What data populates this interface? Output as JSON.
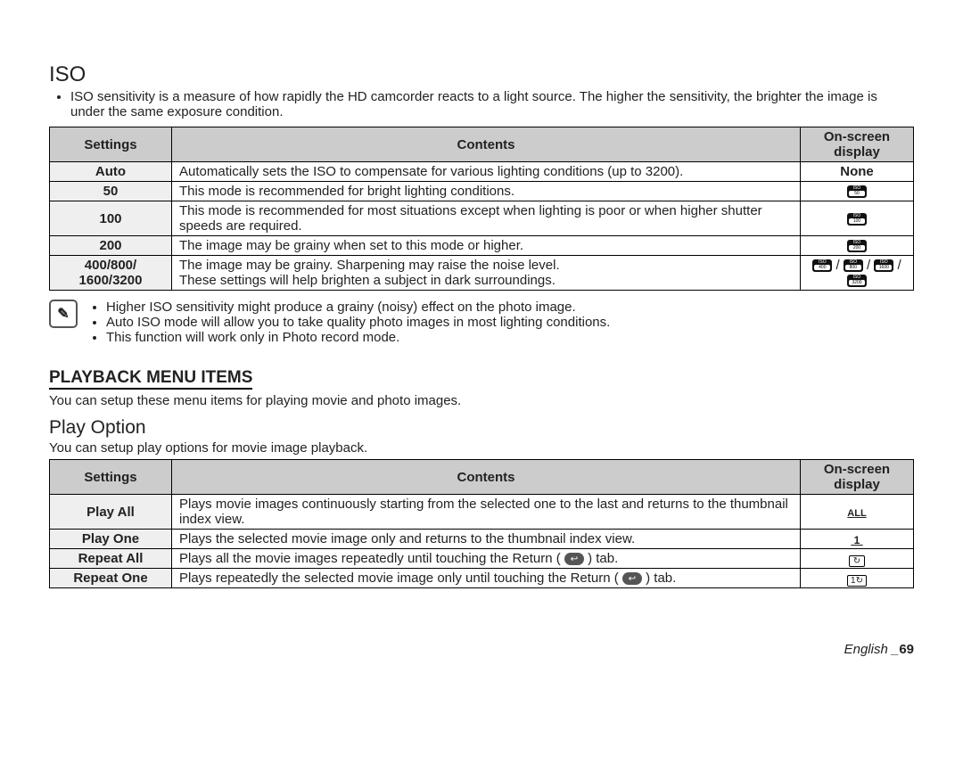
{
  "iso": {
    "title": "ISO",
    "intro": "ISO sensitivity is a measure of how rapidly the HD camcorder reacts to a light source. The higher the sensitivity, the brighter the image is under the same exposure condition.",
    "headers": {
      "settings": "Settings",
      "contents": "Contents",
      "osd": "On-screen display"
    },
    "rows": [
      {
        "setting": "Auto",
        "content": "Automatically sets the ISO to compensate for various lighting conditions (up to 3200).",
        "osd_text": "None"
      },
      {
        "setting": "50",
        "content": "This mode is recommended for bright lighting conditions.",
        "osd_iso": [
          "50"
        ]
      },
      {
        "setting": "100",
        "content": "This mode is recommended for most situations except when lighting is poor or when higher shutter speeds are required.",
        "osd_iso": [
          "100"
        ]
      },
      {
        "setting": "200",
        "content": "The image may be grainy when set to this mode or higher.",
        "osd_iso": [
          "200"
        ]
      },
      {
        "setting": "400/800/\n1600/3200",
        "content": "The image may be grainy. Sharpening may raise the noise level.\nThese settings will help brighten a subject in dark surroundings.",
        "osd_iso": [
          "400",
          "800",
          "1600",
          "3200"
        ]
      }
    ],
    "notes": [
      "Higher ISO sensitivity might produce a grainy (noisy) effect on the photo image.",
      "Auto ISO mode will allow you to take quality photo images in most lighting conditions.",
      "This function will work only in Photo record mode."
    ]
  },
  "playback": {
    "heading": "PLAYBACK MENU ITEMS",
    "intro": "You can setup these menu items for playing movie and photo images.",
    "subheading": "Play Option",
    "subintro": "You can setup play options for movie image playback.",
    "headers": {
      "settings": "Settings",
      "contents": "Contents",
      "osd": "On-screen display"
    },
    "rows": [
      {
        "setting": "Play All",
        "pre": "Plays movie images continuously starting from the selected one to the last and returns to the thumbnail index view.",
        "osd": "ALL"
      },
      {
        "setting": "Play One",
        "pre": "Plays the selected movie image only and returns to the thumbnail index view.",
        "osd": "1"
      },
      {
        "setting": "Repeat All",
        "pre": "Plays all the movie images repeatedly until touching the Return (",
        "post": ") tab.",
        "osd": "⟲▭"
      },
      {
        "setting": "Repeat One",
        "pre": "Plays repeatedly the selected movie image only until touching the Return (",
        "post": ") tab.",
        "osd": "⟲1"
      }
    ]
  },
  "footer": {
    "lang": "English",
    "page": "69"
  }
}
